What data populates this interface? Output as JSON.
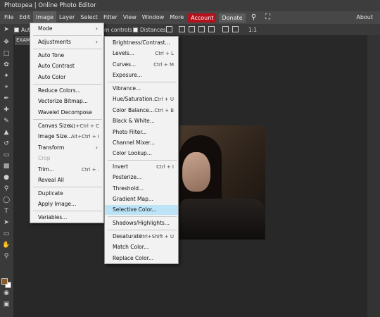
{
  "window": {
    "title": "Photopea | Online Photo Editor"
  },
  "menubar": {
    "items": [
      "File",
      "Edit",
      "Image",
      "Layer",
      "Select",
      "Filter",
      "View",
      "Window",
      "More"
    ],
    "account": "Account",
    "donate": "Donate",
    "about": "About"
  },
  "options": {
    "auto_label": "Auto",
    "transform_controls": "m controls",
    "distances": "Distances",
    "scale": "1:1"
  },
  "document": {
    "tab_label": "EXAM"
  },
  "image_menu": {
    "items": [
      {
        "label": "Mode",
        "submenu": true
      },
      {
        "label": "Adjustments",
        "submenu": true
      },
      {
        "label": "Auto Tone"
      },
      {
        "label": "Auto Contrast"
      },
      {
        "label": "Auto Color"
      },
      {
        "label": "Reduce Colors..."
      },
      {
        "label": "Vectorize Bitmap..."
      },
      {
        "label": "Wavelet Decompose"
      },
      {
        "label": "Canvas Size...",
        "shortcut": "Alt+Ctrl + C"
      },
      {
        "label": "Image Size...",
        "shortcut": "Alt+Ctrl + I"
      },
      {
        "label": "Transform",
        "submenu": true
      },
      {
        "label": "Crop",
        "disabled": true
      },
      {
        "label": "Trim...",
        "shortcut": "Ctrl + ."
      },
      {
        "label": "Reveal All"
      },
      {
        "label": "Duplicate"
      },
      {
        "label": "Apply Image..."
      },
      {
        "label": "Variables..."
      }
    ]
  },
  "adjustments_menu": {
    "items": [
      {
        "label": "Brightness/Contrast..."
      },
      {
        "label": "Levels...",
        "shortcut": "Ctrl + L"
      },
      {
        "label": "Curves...",
        "shortcut": "Ctrl + M"
      },
      {
        "label": "Exposure..."
      },
      {
        "label": "Vibrance..."
      },
      {
        "label": "Hue/Saturation...",
        "shortcut": "Ctrl + U"
      },
      {
        "label": "Color Balance...",
        "shortcut": "Ctrl + B"
      },
      {
        "label": "Black & White..."
      },
      {
        "label": "Photo Filter..."
      },
      {
        "label": "Channel Mixer..."
      },
      {
        "label": "Color Lookup..."
      },
      {
        "label": "Invert",
        "shortcut": "Ctrl + I"
      },
      {
        "label": "Posterize..."
      },
      {
        "label": "Threshold..."
      },
      {
        "label": "Gradient Map..."
      },
      {
        "label": "Selective Color...",
        "highlighted": true
      },
      {
        "label": "Shadows/Highlights..."
      },
      {
        "label": "Desaturate",
        "shortcut": "Ctrl+Shift + U"
      },
      {
        "label": "Match Color..."
      },
      {
        "label": "Replace Color..."
      }
    ]
  },
  "colors": {
    "accent_account": "#b3121d",
    "highlight": "#bde3f7",
    "foreground_swatch": "#8a5a2b"
  }
}
